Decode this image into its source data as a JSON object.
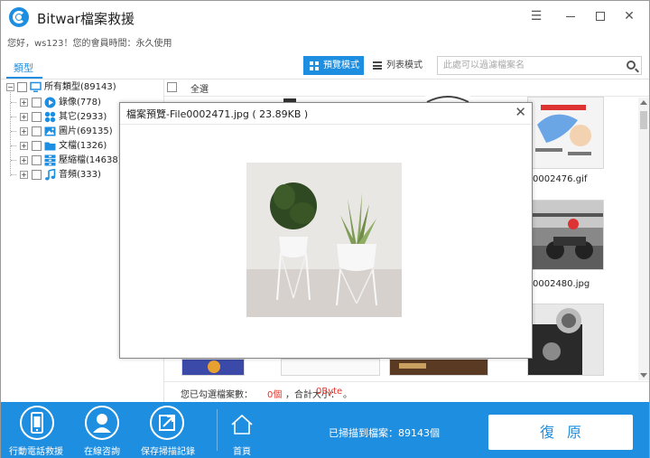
{
  "app": {
    "title": "Bitwar檔案救援",
    "user_line": "您好，ws123！您的會員時間：永久使用",
    "window_controls": [
      "menu-icon",
      "minimize-icon",
      "maximize-icon",
      "close-icon"
    ]
  },
  "toolbar": {
    "type_tab": "類型",
    "preview_mode": "預覽模式",
    "list_mode": "列表模式",
    "search_placeholder": "此處可以過濾檔案名"
  },
  "tree": {
    "root": "所有類型(89143)",
    "children": [
      {
        "label": "錄像(778)",
        "icon": "video-icon"
      },
      {
        "label": "其它(2933)",
        "icon": "other-icon"
      },
      {
        "label": "圖片(69135)",
        "icon": "image-icon"
      },
      {
        "label": "文檔(1326)",
        "icon": "folder-icon"
      },
      {
        "label": "壓縮檔(14638)",
        "icon": "archive-icon"
      },
      {
        "label": "音頻(333)",
        "icon": "music-icon"
      }
    ]
  },
  "grid": {
    "select_all": "全選",
    "files": [
      {
        "name": "0002476.gif"
      },
      {
        "name": "0002480.jpg"
      }
    ]
  },
  "status": {
    "prefix": "您已勾選檔案數：",
    "count": "0個",
    "mid": "，合計大小：",
    "size": "0Byte",
    "suffix": "。"
  },
  "dialog": {
    "title": "檔案預覽-File0002471.jpg ( 23.89KB )"
  },
  "bottom": {
    "mobile_recovery": "行動電話救援",
    "online_consult": "在線咨詢",
    "save_scan": "保存掃描記錄",
    "home": "首頁",
    "scanned": "已掃描到檔案：89143個",
    "restore": "復原"
  },
  "colors": {
    "accent": "#1e8fe0",
    "warning_red": "#e8332b"
  }
}
